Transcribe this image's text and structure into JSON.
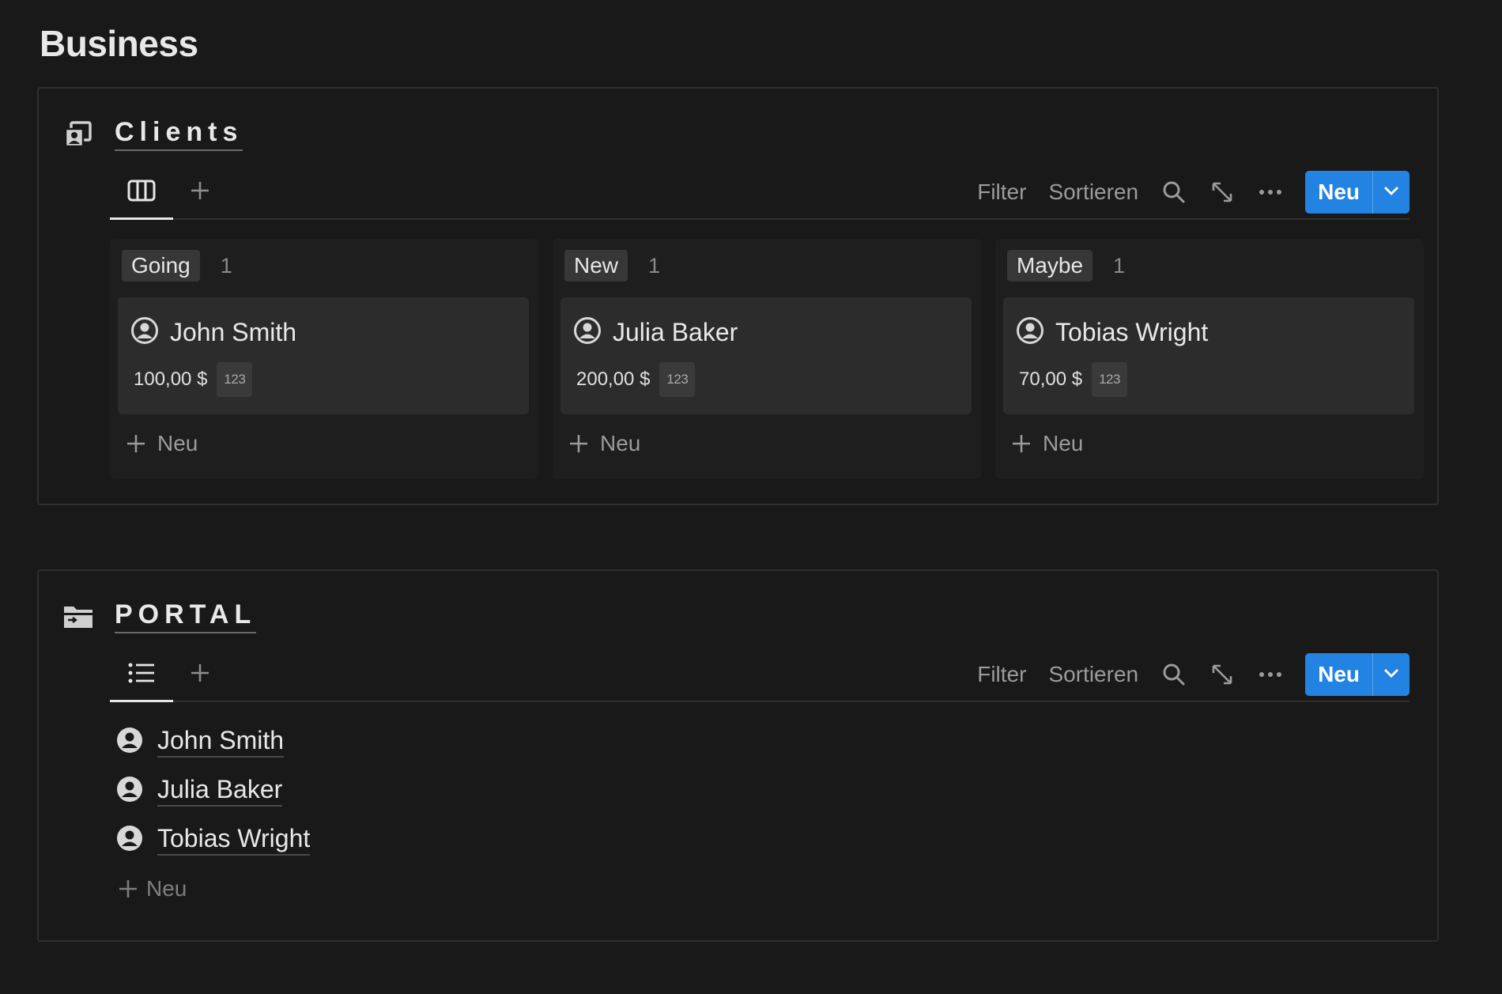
{
  "page": {
    "title": "Business"
  },
  "colors": {
    "background": "#191919",
    "accent": "#2383e2",
    "card": "#2c2c2c",
    "tag": "#373737",
    "muted": "#9b9b9b"
  },
  "clients": {
    "title": "Clients",
    "icon": "contacts-icon",
    "view_icon": "board-view-icon",
    "toolbar": {
      "filter": "Filter",
      "sort": "Sortieren",
      "new": "Neu"
    },
    "columns": [
      {
        "tag": "Going",
        "count": "1",
        "card": {
          "name": "John Smith",
          "price": "100,00 $",
          "badge": "123"
        },
        "new_label": "Neu"
      },
      {
        "tag": "New",
        "count": "1",
        "card": {
          "name": "Julia Baker",
          "price": "200,00 $",
          "badge": "123"
        },
        "new_label": "Neu"
      },
      {
        "tag": "Maybe",
        "count": "1",
        "card": {
          "name": "Tobias Wright",
          "price": "70,00 $",
          "badge": "123"
        },
        "new_label": "Neu"
      }
    ]
  },
  "portal": {
    "title": "PORTAL",
    "icon": "folder-icon",
    "view_icon": "list-view-icon",
    "toolbar": {
      "filter": "Filter",
      "sort": "Sortieren",
      "new": "Neu"
    },
    "items": [
      "John Smith",
      "Julia Baker",
      "Tobias Wright"
    ],
    "new_label": "Neu"
  }
}
